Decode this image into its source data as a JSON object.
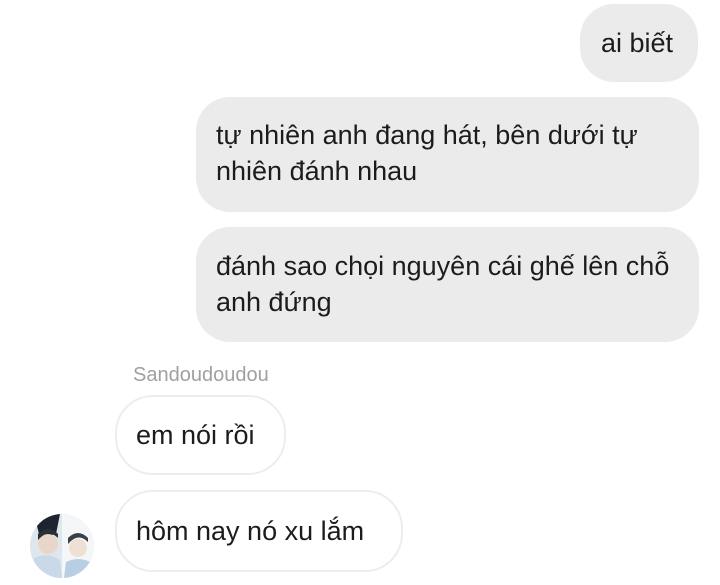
{
  "messages": [
    {
      "direction": "outgoing",
      "text": "ai biết"
    },
    {
      "direction": "outgoing",
      "text": "tự nhiên anh đang hát, bên dưới tự nhiên đánh nhau"
    },
    {
      "direction": "outgoing",
      "text": "đánh sao chọi nguyên cái ghế lên chỗ anh đứng"
    },
    {
      "direction": "incoming",
      "text": "em nói rồi"
    },
    {
      "direction": "incoming",
      "text": "hôm nay nó xu lắm"
    }
  ],
  "incoming_sender": "Sandoudoudou",
  "colors": {
    "outgoing_bubble": "#ebebeb",
    "incoming_bubble": "#ffffff",
    "incoming_border": "#ededed",
    "sender_name": "#a0a0a0"
  },
  "icons": {
    "avatar": "user-avatar-photo"
  }
}
